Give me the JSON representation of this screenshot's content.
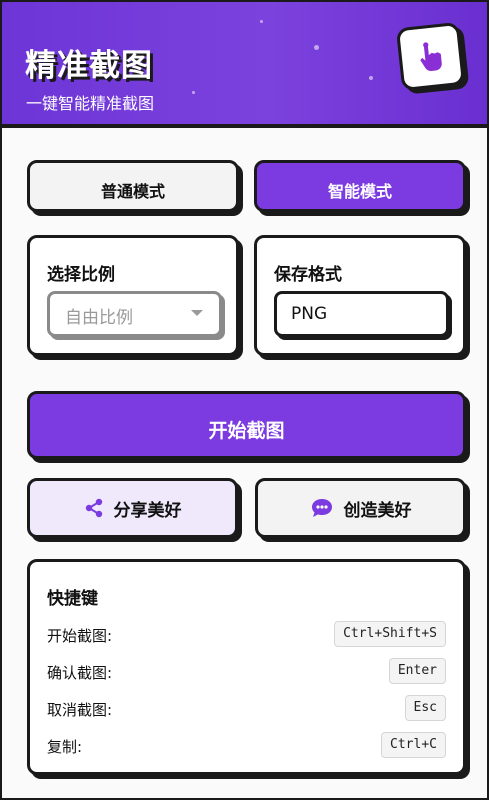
{
  "header": {
    "title": "精准截图",
    "subtitle": "一键智能精准截图",
    "logo_icon": "pointer-hand-icon"
  },
  "modes": {
    "normal_label": "普通模式",
    "smart_label": "智能模式",
    "active": "智能模式"
  },
  "ratio": {
    "label": "选择比例",
    "value": "自由比例"
  },
  "format": {
    "label": "保存格式",
    "value": "PNG"
  },
  "start_button": {
    "label": "开始截图"
  },
  "share_button": {
    "label": "分享美好",
    "icon": "share-icon"
  },
  "create_button": {
    "label": "创造美好",
    "icon": "chat-bubble-icon"
  },
  "shortcuts": {
    "title": "快捷键",
    "items": [
      {
        "label": "开始截图:",
        "key": "Ctrl+Shift+S"
      },
      {
        "label": "确认截图:",
        "key": "Enter"
      },
      {
        "label": "取消截图:",
        "key": "Esc"
      },
      {
        "label": "复制:",
        "key": "Ctrl+C"
      }
    ]
  },
  "colors": {
    "accent": "#7c3be0",
    "border": "#1a1a1a",
    "share_bg": "#efe9fb"
  }
}
